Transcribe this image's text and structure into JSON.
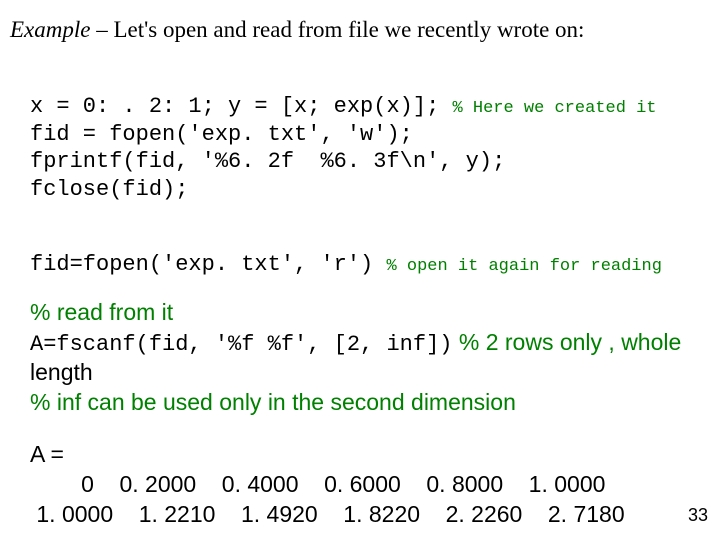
{
  "heading": {
    "prefix": "Example",
    "rest": " – Let's open and read from file we recently wrote on:"
  },
  "code1": {
    "l1a": "x = 0: . 2: 1; y = [x; exp(x)]; ",
    "l1b": "% Here we created it",
    "l2": "fid = fopen('exp. txt', 'w');",
    "l3": "fprintf(fid, '%6. 2f  %6. 3f\\n', y);",
    "l4": "fclose(fid);"
  },
  "code2": {
    "a": "fid=fopen('exp. txt', 'r') ",
    "b": "% open it again for reading"
  },
  "para": {
    "l1": "% read from it",
    "l2a": "A=fscanf(fid, '%f %f', [2, inf])",
    "l2b": " % 2 rows only , whole",
    "l3": "length",
    "l4": "% inf can be used only in the second dimension"
  },
  "matrix": {
    "label": "A =",
    "row1": "        0    0. 2000    0. 4000    0. 6000    0. 8000    1. 0000",
    "row2": " 1. 0000    1. 2210    1. 4920    1. 8220    2. 2260    2. 7180"
  },
  "page_number": "33",
  "chart_data": {
    "type": "table",
    "title": "A",
    "columns": [
      "c1",
      "c2",
      "c3",
      "c4",
      "c5",
      "c6"
    ],
    "rows": [
      [
        0,
        0.2,
        0.4,
        0.6,
        0.8,
        1.0
      ],
      [
        1.0,
        1.221,
        1.492,
        1.822,
        2.226,
        2.718
      ]
    ]
  }
}
